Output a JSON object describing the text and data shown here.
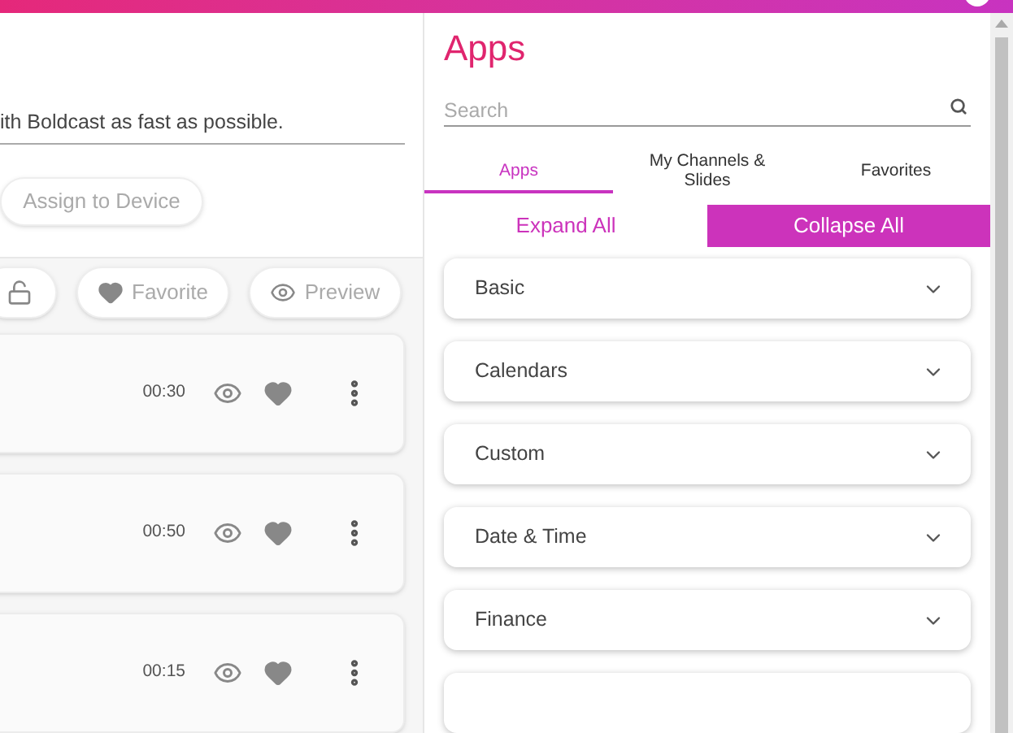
{
  "editor": {
    "description_value": "ith Boldcast as fast as possible.",
    "assign_button": "Assign to Device"
  },
  "toolbar": {
    "buttons": [
      {
        "kind": "lock"
      },
      {
        "kind": "favorite",
        "label": "Favorite"
      },
      {
        "kind": "preview",
        "label": "Preview"
      }
    ]
  },
  "slides": [
    {
      "duration": "00:30"
    },
    {
      "duration": "00:50"
    },
    {
      "duration": "00:15"
    }
  ],
  "apps_panel": {
    "title": "Apps",
    "search": {
      "placeholder": "Search"
    },
    "tabs": [
      {
        "label": "Apps",
        "selected": true
      },
      {
        "label": "My Channels & Slides",
        "selected": false
      },
      {
        "label": "Favorites",
        "selected": false
      }
    ],
    "toggle": [
      {
        "label": "Expand All",
        "selected": false
      },
      {
        "label": "Collapse All",
        "selected": true
      }
    ],
    "categories": [
      {
        "kind": "category",
        "label": "Basic",
        "expanded": false
      },
      {
        "kind": "category",
        "label": "Calendars",
        "expanded": false
      },
      {
        "kind": "category",
        "label": "Custom",
        "expanded": false
      },
      {
        "kind": "category",
        "label": "Date & Time",
        "expanded": false
      },
      {
        "kind": "category",
        "label": "Finance",
        "expanded": false
      },
      {
        "kind": "blank"
      }
    ]
  }
}
